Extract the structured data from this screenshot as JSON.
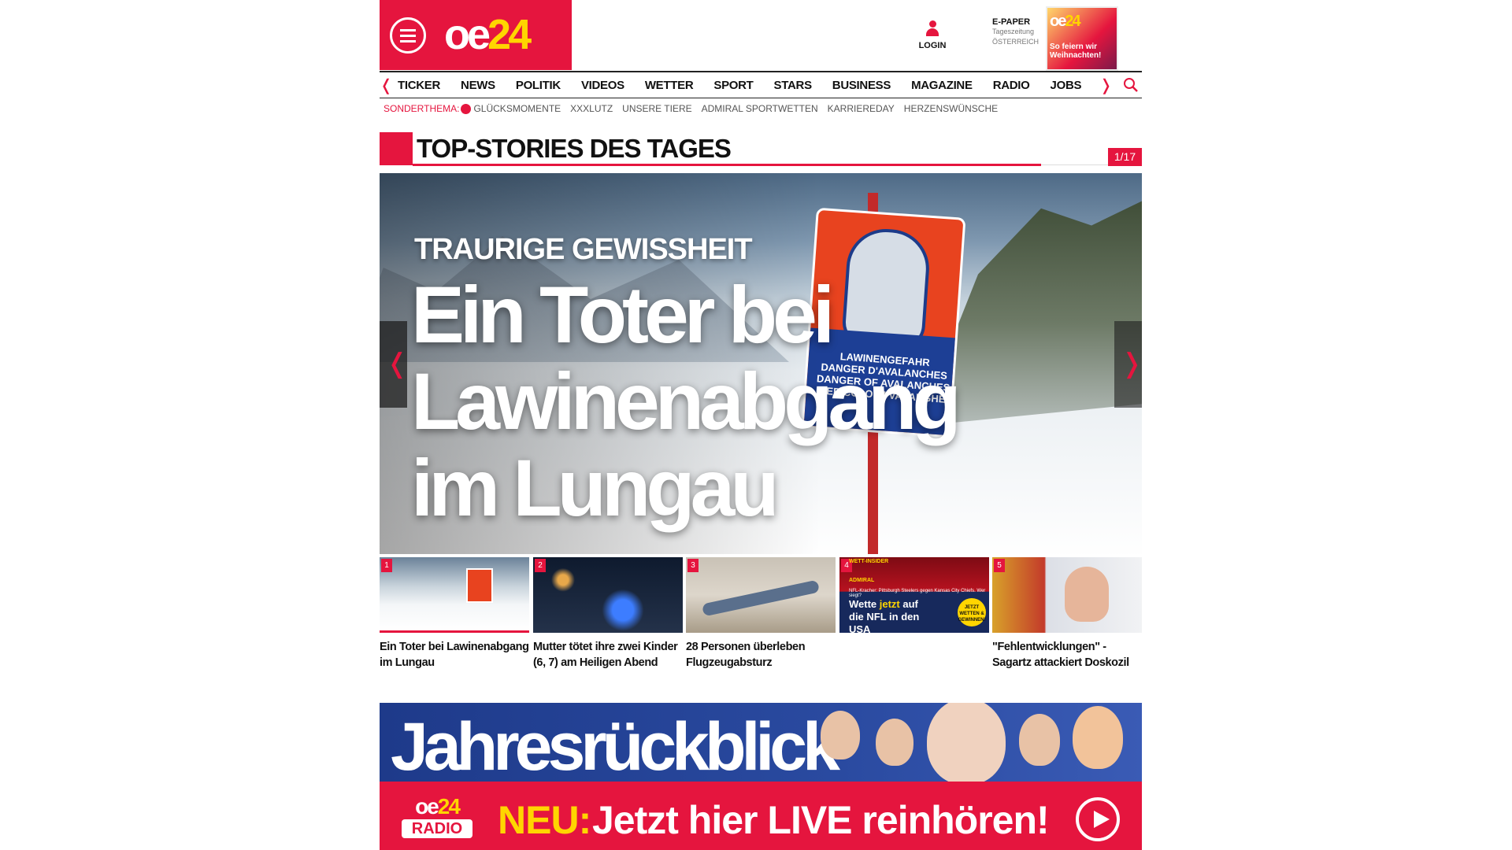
{
  "header": {
    "logo_oe": "oe",
    "logo_24": "24",
    "login_label": "LOGIN",
    "epaper": {
      "title": "E-PAPER",
      "sub1": "Tageszeitung",
      "sub2": "ÖSTERREICH",
      "cover_logo_oe": "oe",
      "cover_logo_24": "24",
      "cover_headline": "So feiern wir Weihnachten!"
    }
  },
  "nav": {
    "items": [
      "TICKER",
      "NEWS",
      "POLITIK",
      "VIDEOS",
      "WETTER",
      "SPORT",
      "STARS",
      "BUSINESS",
      "MAGAZINE",
      "RADIO",
      "JOBS"
    ],
    "prev_glyph": "❬",
    "next_glyph": "❭"
  },
  "subnav": {
    "label": "SONDERTHEMA:",
    "items": [
      "GLÜCKSMOMENTE",
      "XXXLUTZ",
      "UNSERE TIERE",
      "ADMIRAL SPORTWETTEN",
      "KARRIEREDAY",
      "HERZENSWÜNSCHE"
    ]
  },
  "section": {
    "title": "TOP-STORIES DES TAGES",
    "counter": "1/17"
  },
  "hero": {
    "kicker": "TRAURIGE GEWISSHEIT",
    "headline": "Ein Toter bei Lawinenabgang im Lungau",
    "sign_text": "LAWINENGEFAHR DANGER D'AVALANCHES DANGER OF AVALANCHES PERICOLO DI VALANGHE",
    "prev_glyph": "❬",
    "next_glyph": "❭"
  },
  "thumbs": [
    {
      "num": "1",
      "caption": "Ein Toter bei Lawinenabgang im Lungau"
    },
    {
      "num": "2",
      "caption": "Mutter tötet ihre zwei Kinder (6, 7) am Heiligen Abend"
    },
    {
      "num": "3",
      "caption": "28 Personen überleben Flugzeugabsturz"
    },
    {
      "num": "4",
      "caption": "",
      "ad_top": "WETT-INSIDER",
      "ad_brand": "ADMIRAL",
      "ad_small": "NFL-Kracher: Pittsburgh Steelers gegen Kansas City Chiefs. Wer siegt?",
      "ad_main_1": "Wette ",
      "ad_main_2": "jetzt",
      "ad_main_3": " auf die NFL in den USA",
      "ad_badge": "JETZT WETTEN & GEWINNEN!"
    },
    {
      "num": "5",
      "caption": "\"Fehlentwicklungen\" - Sagartz attackiert Doskozil"
    }
  ],
  "banner": {
    "headline": "Jahresrückblick",
    "radio_oe": "oe",
    "radio_24": "24",
    "radio_label": "RADIO",
    "neu": "NEU:",
    "cta": "Jetzt hier LIVE reinhören!"
  },
  "colors": {
    "brand_red": "#e5153e",
    "brand_yellow": "#ffd500"
  }
}
